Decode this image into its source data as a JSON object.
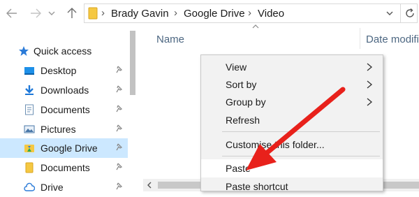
{
  "address_bar": {
    "crumbs": [
      "Brady Gavin",
      "Google Drive",
      "Video"
    ]
  },
  "sidebar": {
    "items": [
      {
        "label": "Quick access",
        "icon": "star-icon"
      },
      {
        "label": "Desktop",
        "icon": "desktop-icon"
      },
      {
        "label": "Downloads",
        "icon": "download-icon"
      },
      {
        "label": "Documents",
        "icon": "document-icon"
      },
      {
        "label": "Pictures",
        "icon": "pictures-icon"
      },
      {
        "label": "Google Drive",
        "icon": "google-drive-icon"
      },
      {
        "label": "Documents",
        "icon": "folder-icon"
      },
      {
        "label": "Drive",
        "icon": "cloud-drive-icon"
      }
    ]
  },
  "columns": {
    "name": "Name",
    "date": "Date modifi"
  },
  "context_menu": {
    "items": [
      {
        "label": "View",
        "submenu": true
      },
      {
        "label": "Sort by",
        "submenu": true
      },
      {
        "label": "Group by",
        "submenu": true
      },
      {
        "label": "Refresh",
        "submenu": false
      },
      {
        "label": "Customise this folder...",
        "submenu": false
      },
      {
        "label": "Paste",
        "submenu": false
      },
      {
        "label": "Paste shortcut",
        "submenu": false
      }
    ]
  },
  "colors": {
    "selected_bg": "#cce8ff",
    "annotation_arrow": "#e8211b",
    "menu_bg": "#f2f2f2"
  }
}
